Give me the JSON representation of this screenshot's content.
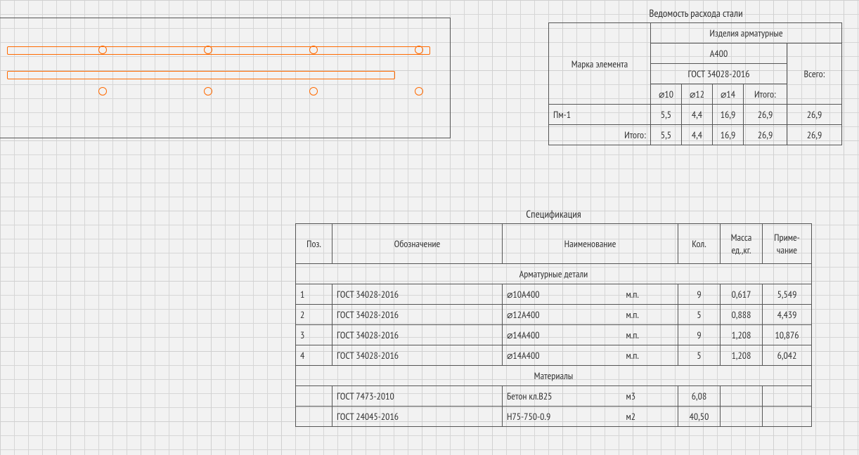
{
  "steel_table": {
    "title": "Ведомость расхода стали",
    "hdr_products": "Изделия арматурные",
    "hdr_class": "А400",
    "hdr_gost": "ГОСТ 34028-2016",
    "hdr_mark": "Марка элемента",
    "d10": "⌀10",
    "d12": "⌀12",
    "d14": "⌀14",
    "itogo": "Итого:",
    "vsego": "Всего:",
    "row1": {
      "mark": "Пм-1",
      "d10": "5,5",
      "d12": "4,4",
      "d14": "16,9",
      "itogo": "26,9",
      "vsego": "26,9"
    },
    "row2": {
      "mark": "Итого:",
      "d10": "5,5",
      "d12": "4,4",
      "d14": "16,9",
      "itogo": "26,9",
      "vsego": "26,9"
    }
  },
  "spec": {
    "title": "Спецификация",
    "hdr_pos": "Поз.",
    "hdr_des": "Обозначение",
    "hdr_name": "Наименование",
    "hdr_qty": "Кол.",
    "hdr_mass": "Масса ед.,кг.",
    "hdr_note": "Приме-\nчание",
    "group1": "Арматурные детали",
    "group2": "Материалы",
    "rows": [
      {
        "pos": "1",
        "des": "ГОСТ 34028-2016",
        "name": "⌀10А400",
        "unit": "м.п.",
        "qty": "9",
        "mass": "0,617",
        "note": "5,549"
      },
      {
        "pos": "2",
        "des": "ГОСТ 34028-2016",
        "name": "⌀12А400",
        "unit": "м.п.",
        "qty": "5",
        "mass": "0,888",
        "note": "4,439"
      },
      {
        "pos": "3",
        "des": "ГОСТ 34028-2016",
        "name": "⌀14А400",
        "unit": "м.п.",
        "qty": "9",
        "mass": "1,208",
        "note": "10,876"
      },
      {
        "pos": "4",
        "des": "ГОСТ 34028-2016",
        "name": "⌀14А400",
        "unit": "м.п.",
        "qty": "5",
        "mass": "1,208",
        "note": "6,042"
      }
    ],
    "mats": [
      {
        "pos": "",
        "des": "ГОСТ 7473-2010",
        "name": "Бетон кл.В25",
        "unit": "м3",
        "qty": "6,08",
        "mass": "",
        "note": ""
      },
      {
        "pos": "",
        "des": "ГОСТ 24045-2016",
        "name": "Н75-750-0.9",
        "unit": "м2",
        "qty": "40,50",
        "mass": "",
        "note": ""
      }
    ]
  },
  "chart_data": {
    "type": "table",
    "title": "Ведомость расхода стали / Спецификация",
    "steel_consumption": {
      "element": "Пм-1",
      "class": "А400",
      "gost": "ГОСТ 34028-2016",
      "diameters_mm": [
        10,
        12,
        14
      ],
      "mass_kg": [
        5.5,
        4.4,
        16.9
      ],
      "subtotal_kg": 26.9,
      "total_kg": 26.9
    },
    "specification": {
      "rebar": [
        {
          "pos": 1,
          "gost": "ГОСТ 34028-2016",
          "name": "⌀10А400",
          "unit": "м.п.",
          "qty": 9,
          "unit_mass_kg": 0.617,
          "total": 5.549
        },
        {
          "pos": 2,
          "gost": "ГОСТ 34028-2016",
          "name": "⌀12А400",
          "unit": "м.п.",
          "qty": 5,
          "unit_mass_kg": 0.888,
          "total": 4.439
        },
        {
          "pos": 3,
          "gost": "ГОСТ 34028-2016",
          "name": "⌀14А400",
          "unit": "м.п.",
          "qty": 9,
          "unit_mass_kg": 1.208,
          "total": 10.876
        },
        {
          "pos": 4,
          "gost": "ГОСТ 34028-2016",
          "name": "⌀14А400",
          "unit": "м.п.",
          "qty": 5,
          "unit_mass_kg": 1.208,
          "total": 6.042
        }
      ],
      "materials": [
        {
          "gost": "ГОСТ 7473-2010",
          "name": "Бетон кл.В25",
          "unit": "м3",
          "qty": 6.08
        },
        {
          "gost": "ГОСТ 24045-2016",
          "name": "Н75-750-0.9",
          "unit": "м2",
          "qty": 40.5
        }
      ]
    }
  }
}
